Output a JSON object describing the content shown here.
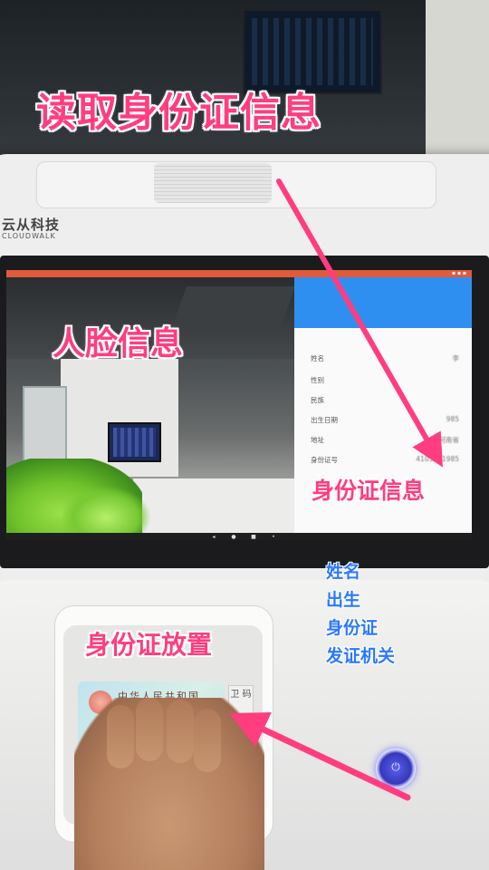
{
  "captions": {
    "title": "读取身份证信息",
    "face_info": "人脸信息",
    "id_info": "身份证信息",
    "id_place": "身份证放置"
  },
  "fields_list": [
    "姓名",
    "出生",
    "身份证",
    "发证机关"
  ],
  "device": {
    "brand_cn": "云从科技",
    "brand_en": "CLOUDWALK"
  },
  "info_panel": {
    "rows": [
      {
        "label": "姓名",
        "value": "李"
      },
      {
        "label": "性别",
        "value": ""
      },
      {
        "label": "民族",
        "value": ""
      },
      {
        "label": "出生日期",
        "value": "985"
      },
      {
        "label": "地址",
        "value": "河南省"
      },
      {
        "label": "身份证号",
        "value": "4103221985"
      }
    ]
  },
  "id_card": {
    "text": "中华人民共和国",
    "side_label": "卫 码"
  },
  "colors": {
    "caption_pink": "#ff3d7f",
    "fields_blue": "#2a78ff",
    "panel_header": "#2f8ff0",
    "status_bar": "#e05a3c"
  },
  "icons": {
    "power": "power-icon",
    "nav": [
      "back-icon",
      "home-icon",
      "recent-icon"
    ]
  }
}
